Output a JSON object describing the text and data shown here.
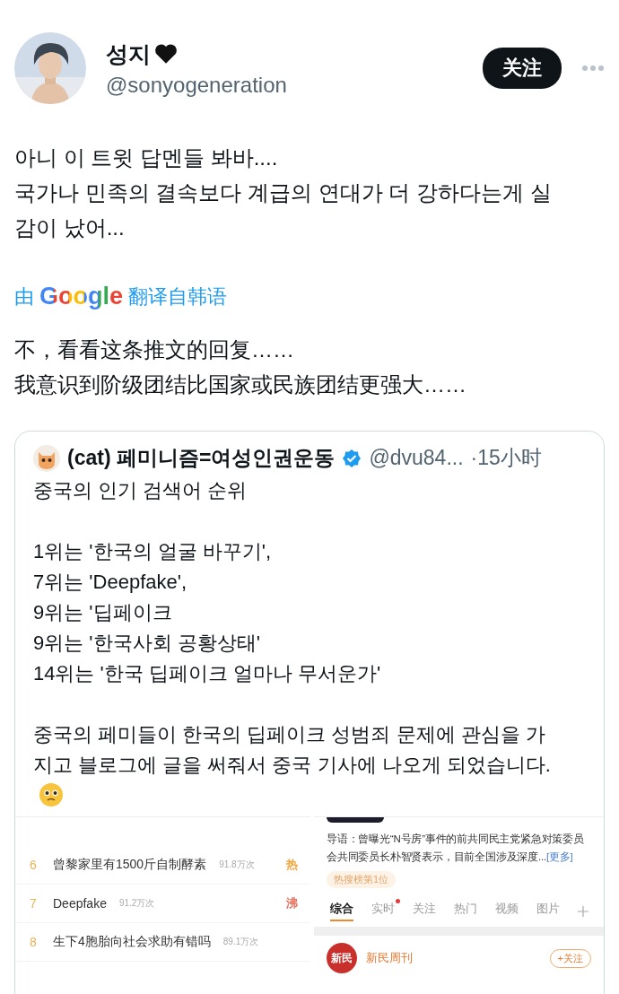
{
  "author": {
    "name": "성지",
    "handle": "@sonyogeneration",
    "follow_label": "关注"
  },
  "tweet_lines": [
    "아니 이 트윗 답멘들 봐바....",
    "국가나 민족의 결속보다 계급의 연대가 더 강하다는게 실",
    "감이 났어..."
  ],
  "translation": {
    "prefix": "由",
    "brand": "Google",
    "suffix": "翻译自韩语"
  },
  "translated_lines": [
    "不，看看这条推文的回复……",
    "我意识到阶级团结比国家或民族团结更强大……"
  ],
  "quote": {
    "author": "(cat) 페미니즘=여성인권운동",
    "verified": true,
    "handle": "@dvu84...",
    "time": "·15小时",
    "paragraphs": [
      [
        "중국의 인기 검색어 순위"
      ],
      [
        "1위는 '한국의 얼굴 바꾸기',",
        "7위는 'Deepfake',",
        "9위는 '딥페이크",
        "9위는 '한국사회 공황상태'",
        "14위는 '한국 딥페이크 얼마나 무서운가'"
      ],
      [
        "중국의 페미들이 한국의 딥페이크 성범죄 문제에 관심을 가",
        "지고 블로그에 글을 써줘서 중국 기사에 나오게 되었습니다."
      ]
    ],
    "trending": [
      {
        "rank": "6",
        "title": "曾黎家里有1500斤自制酵素",
        "count": "91.8万次",
        "badge": "热",
        "color": "#f2a53c"
      },
      {
        "rank": "7",
        "title": "Deepfake",
        "count": "91.2万次",
        "badge": "沸",
        "color": "#e8735f"
      },
      {
        "rank": "8",
        "title": "生下4胞胎向社会求助有错吗",
        "count": "89.1万次"
      }
    ],
    "article": {
      "lead": "导语：曾曝光“N号房”事件的前共同民主党紧急对策委员会共同委员长朴智贤表示，目前全国涉及深度...",
      "more": "[更多]",
      "tag": "热搜榜第1位",
      "tabs": [
        {
          "label": "综合",
          "selected": true,
          "dot": false
        },
        {
          "label": "实时",
          "selected": false,
          "dot": true
        },
        {
          "label": "关注",
          "selected": false,
          "dot": false
        },
        {
          "label": "热门",
          "selected": false,
          "dot": false
        },
        {
          "label": "视频",
          "selected": false,
          "dot": false
        },
        {
          "label": "图片",
          "selected": false,
          "dot": false
        }
      ],
      "account": {
        "logo": "新民",
        "name": "新民周刊",
        "follow": "+关注"
      }
    }
  }
}
